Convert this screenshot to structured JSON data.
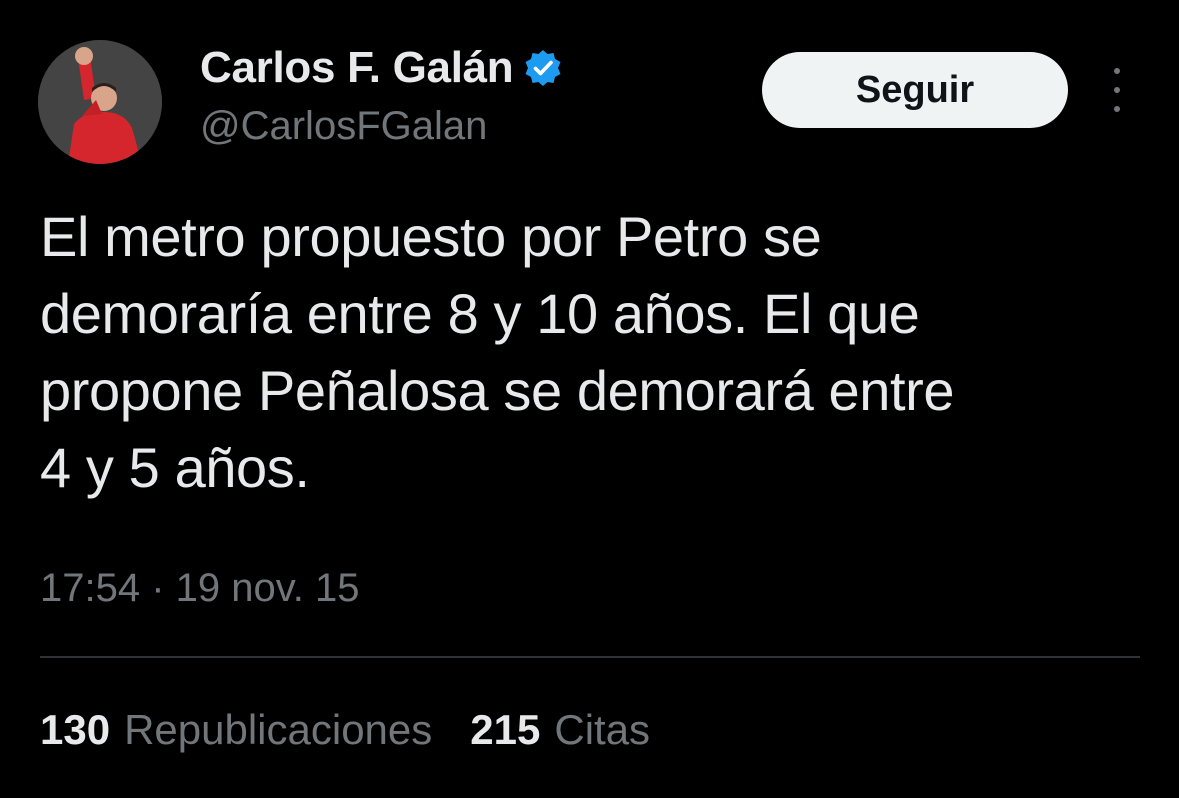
{
  "author": {
    "display_name": "Carlos F. Galán",
    "handle": "@CarlosFGalan",
    "verified": true,
    "avatar_icon": "profile-photo-red-shirt-raised-fist"
  },
  "actions": {
    "follow_label": "Seguir",
    "more_icon": "vertical-ellipsis-icon"
  },
  "tweet": {
    "lines": [
      "El metro propuesto por Petro se",
      "demoraría entre 8 y 10 años. El que",
      "propone Peñalosa se demorará entre",
      "4 y 5 años."
    ],
    "timestamp": "17:54 · 19 nov. 15"
  },
  "stats": {
    "reposts_count": "130",
    "reposts_label": "Republicaciones",
    "quotes_count": "215",
    "quotes_label": "Citas"
  },
  "colors": {
    "background": "#000000",
    "primary_text": "#e7e9ea",
    "secondary_text": "#71767b",
    "verified_blue": "#1d9bf0",
    "follow_button_bg": "#eff3f4",
    "divider": "#2f3336"
  }
}
